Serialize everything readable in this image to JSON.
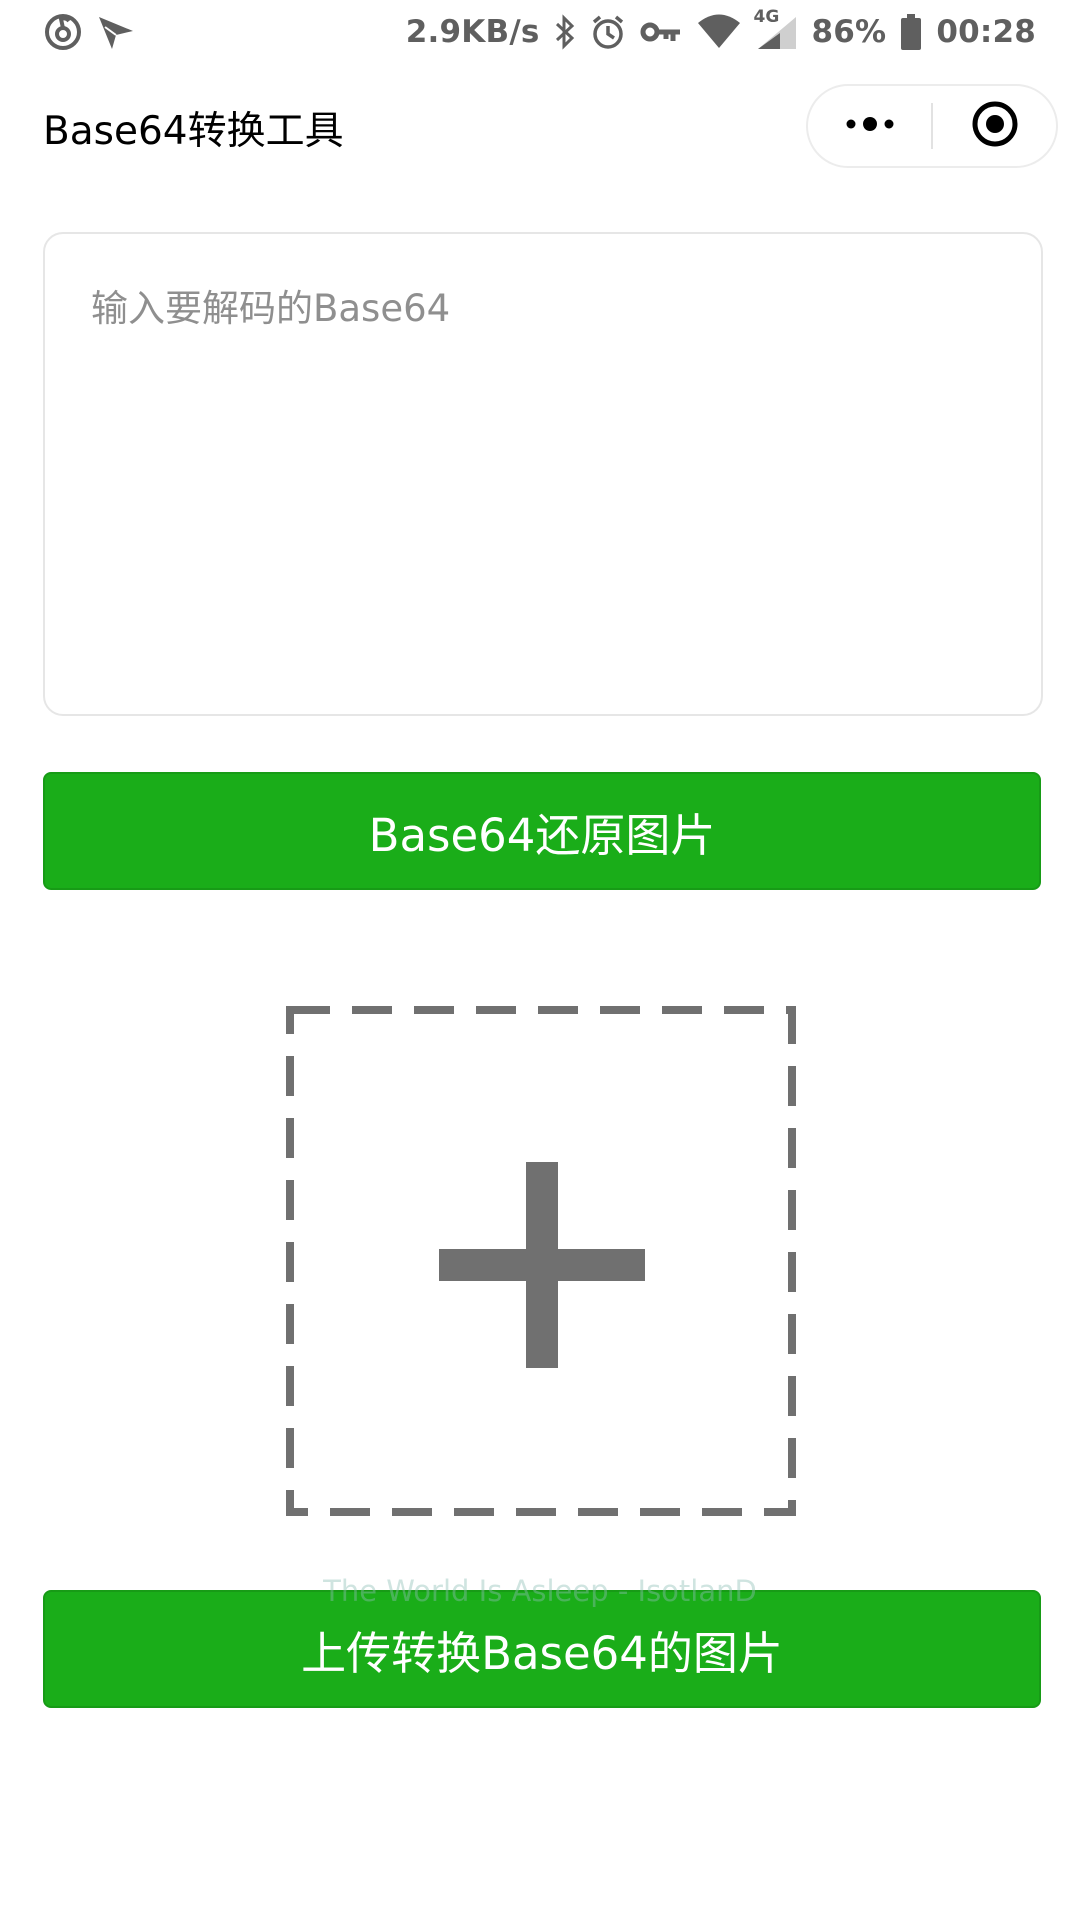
{
  "status_bar": {
    "network_speed": "2.9KB/s",
    "network_type": "4G",
    "battery": "86%",
    "time": "00:28",
    "icons": [
      "netease-music-icon",
      "send-icon",
      "bluetooth-icon",
      "alarm-icon",
      "vpn-key-icon",
      "wifi-icon",
      "signal-icon",
      "battery-icon"
    ]
  },
  "nav": {
    "title": "Base64转换工具",
    "menu_icon": "more-dots-icon",
    "close_icon": "target-circle-icon"
  },
  "decode": {
    "placeholder": "输入要解码的Base64",
    "value": "",
    "button_label": "Base64还原图片"
  },
  "upload": {
    "icon": "plus-icon",
    "button_label": "上传转换Base64的图片"
  },
  "overlay": {
    "watermark": "The World Is Asleep - IsotlanD"
  },
  "colors": {
    "primary_green": "#1aad19",
    "dash_gray": "#707070",
    "placeholder_gray": "#8f8f8f"
  }
}
